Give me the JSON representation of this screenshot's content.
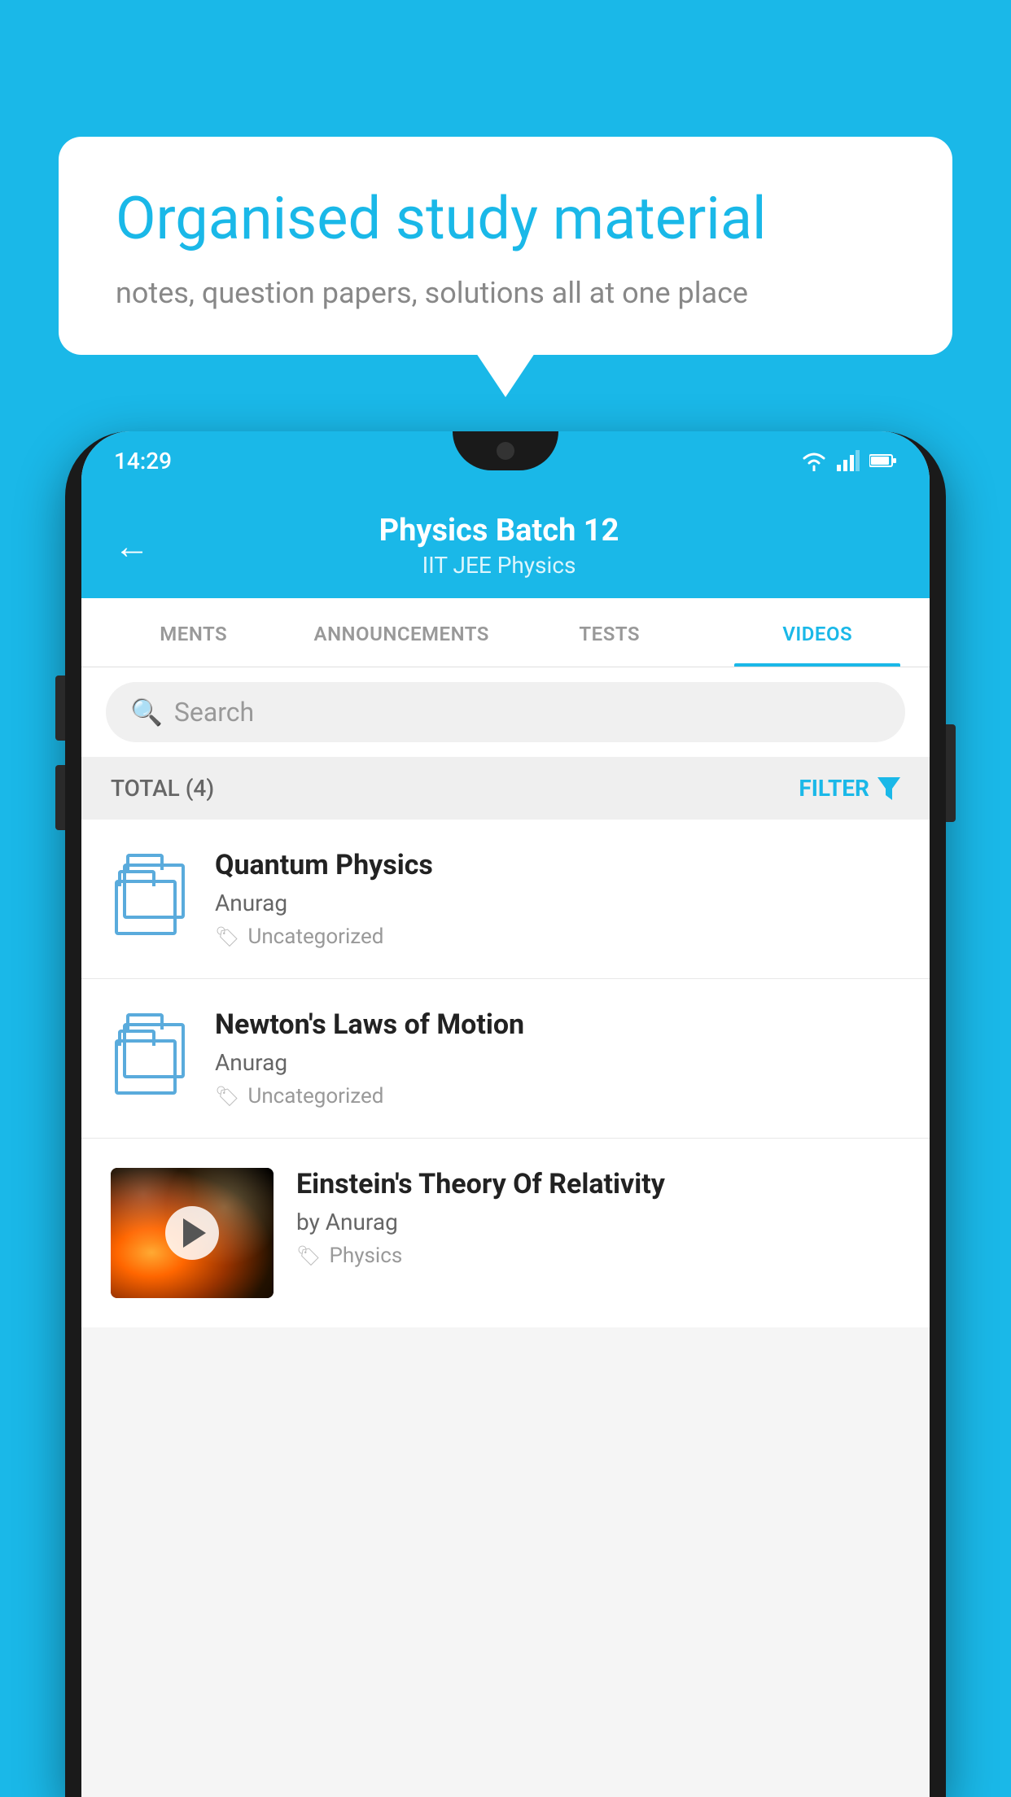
{
  "background_color": "#1ab8e8",
  "speech_bubble": {
    "title": "Organised study material",
    "subtitle": "notes, question papers, solutions all at one place"
  },
  "phone": {
    "status_bar": {
      "time": "14:29",
      "icons": [
        "wifi",
        "signal",
        "battery"
      ]
    },
    "header": {
      "back_label": "←",
      "title": "Physics Batch 12",
      "subtitle": "IIT JEE   Physics"
    },
    "tabs": [
      {
        "label": "MENTS",
        "active": false
      },
      {
        "label": "ANNOUNCEMENTS",
        "active": false
      },
      {
        "label": "TESTS",
        "active": false
      },
      {
        "label": "VIDEOS",
        "active": true
      }
    ],
    "search": {
      "placeholder": "Search"
    },
    "filter_bar": {
      "total_label": "TOTAL (4)",
      "filter_label": "FILTER"
    },
    "videos": [
      {
        "title": "Quantum Physics",
        "author": "Anurag",
        "tag": "Uncategorized",
        "has_thumbnail": false
      },
      {
        "title": "Newton's Laws of Motion",
        "author": "Anurag",
        "tag": "Uncategorized",
        "has_thumbnail": false
      },
      {
        "title": "Einstein's Theory Of Relativity",
        "author": "by Anurag",
        "tag": "Physics",
        "has_thumbnail": true
      }
    ]
  }
}
